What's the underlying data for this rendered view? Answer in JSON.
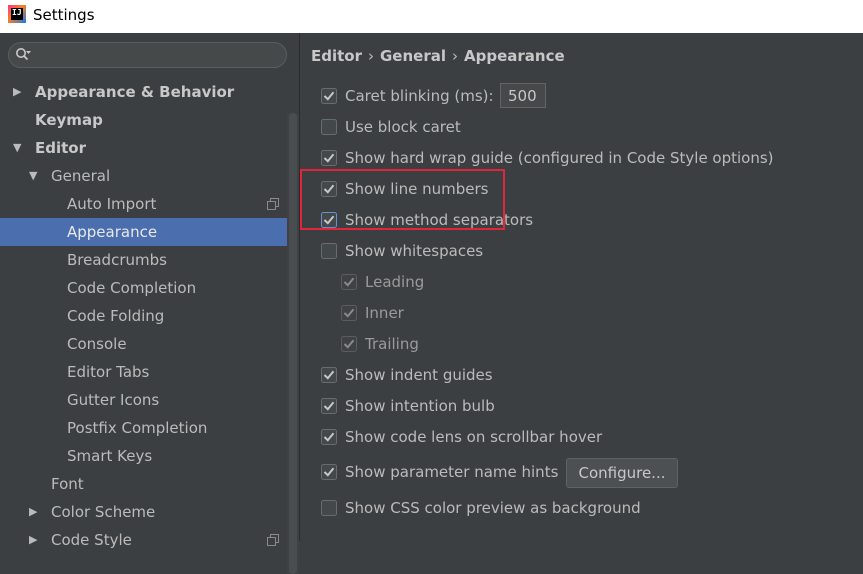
{
  "window": {
    "title": "Settings",
    "app_icon_text": "IJ"
  },
  "sidebar": {
    "search": {
      "value": "",
      "placeholder": ""
    },
    "tree": [
      {
        "label": "Appearance & Behavior",
        "level": 0,
        "bold": true,
        "arrow": "collapsed"
      },
      {
        "label": "Keymap",
        "level": 0,
        "bold": true,
        "arrow": "none"
      },
      {
        "label": "Editor",
        "level": 0,
        "bold": true,
        "arrow": "expanded"
      },
      {
        "label": "General",
        "level": 1,
        "bold": false,
        "arrow": "expanded"
      },
      {
        "label": "Auto Import",
        "level": 2,
        "bold": false,
        "arrow": "none",
        "project_icon": true
      },
      {
        "label": "Appearance",
        "level": 2,
        "bold": false,
        "arrow": "none",
        "selected": true
      },
      {
        "label": "Breadcrumbs",
        "level": 2,
        "bold": false,
        "arrow": "none"
      },
      {
        "label": "Code Completion",
        "level": 2,
        "bold": false,
        "arrow": "none"
      },
      {
        "label": "Code Folding",
        "level": 2,
        "bold": false,
        "arrow": "none"
      },
      {
        "label": "Console",
        "level": 2,
        "bold": false,
        "arrow": "none"
      },
      {
        "label": "Editor Tabs",
        "level": 2,
        "bold": false,
        "arrow": "none"
      },
      {
        "label": "Gutter Icons",
        "level": 2,
        "bold": false,
        "arrow": "none"
      },
      {
        "label": "Postfix Completion",
        "level": 2,
        "bold": false,
        "arrow": "none"
      },
      {
        "label": "Smart Keys",
        "level": 2,
        "bold": false,
        "arrow": "none"
      },
      {
        "label": "Font",
        "level": 1,
        "bold": false,
        "arrow": "none"
      },
      {
        "label": "Color Scheme",
        "level": 1,
        "bold": false,
        "arrow": "collapsed"
      },
      {
        "label": "Code Style",
        "level": 1,
        "bold": false,
        "arrow": "collapsed",
        "project_icon": true
      }
    ]
  },
  "main": {
    "breadcrumb": [
      "Editor",
      "General",
      "Appearance"
    ],
    "breadcrumb_separator": "›",
    "options": [
      {
        "label": "Caret blinking (ms):",
        "checked": true,
        "sub": false,
        "disabled": false
      },
      {
        "label": "Use block caret",
        "checked": false,
        "sub": false,
        "disabled": false
      },
      {
        "label": "Show hard wrap guide (configured in Code Style options)",
        "checked": true,
        "sub": false,
        "disabled": false
      },
      {
        "label": "Show line numbers",
        "checked": true,
        "sub": false,
        "disabled": false
      },
      {
        "label": "Show method separators",
        "checked": true,
        "sub": false,
        "disabled": false,
        "focused": true
      },
      {
        "label": "Show whitespaces",
        "checked": false,
        "sub": false,
        "disabled": false
      },
      {
        "label": "Leading",
        "checked": true,
        "sub": true,
        "disabled": true
      },
      {
        "label": "Inner",
        "checked": true,
        "sub": true,
        "disabled": true
      },
      {
        "label": "Trailing",
        "checked": true,
        "sub": true,
        "disabled": true
      },
      {
        "label": "Show indent guides",
        "checked": true,
        "sub": false,
        "disabled": false
      },
      {
        "label": "Show intention bulb",
        "checked": true,
        "sub": false,
        "disabled": false
      },
      {
        "label": "Show code lens on scrollbar hover",
        "checked": true,
        "sub": false,
        "disabled": false
      },
      {
        "label": "Show parameter name hints",
        "checked": true,
        "sub": false,
        "disabled": false
      },
      {
        "label": "Show CSS color preview as background",
        "checked": false,
        "sub": false,
        "disabled": false
      }
    ],
    "caret_blink_value": "500",
    "configure_button": "Configure..."
  },
  "colors": {
    "background": "#3c3f41",
    "selection": "#4b6eaf",
    "highlight_box": "#e0263a"
  }
}
